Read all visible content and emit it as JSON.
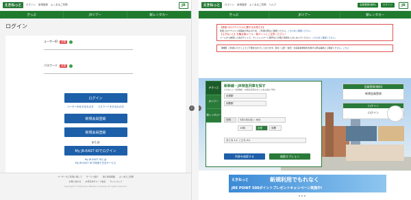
{
  "left": {
    "header": {
      "logo": "えきねっと",
      "links": [
        "ログイン",
        "新規登録",
        "よくあるご質問"
      ],
      "jr_mark": "JR"
    },
    "nav": [
      "きっぷ",
      "JRツアー",
      "駅レンタカー"
    ],
    "title": "ログイン",
    "fields": [
      {
        "label": "ユーザーID",
        "required": "必須"
      },
      {
        "label": "パスワード",
        "required": "必須"
      }
    ],
    "login_button": "ログイン",
    "links_row": [
      "ユーザーIDをお忘れの方",
      "パスワードをお忘れの方"
    ],
    "register_button_1": "新規会員登録",
    "register_button_2": "新規会員登録",
    "or_text": "または",
    "jre_button": "My JR-EAST IDでログイン",
    "small_links": [
      "My JR-EAST IDとは",
      "My JR-EAST IDで利用できるサービス"
    ],
    "footer_links": [
      "ユーザーのご利用に関して",
      "サービス紹介",
      "個人情報保護",
      "よくあるご質問"
    ],
    "footer_links2": [
      "お問い合わせ",
      "JR東日本グループ会社",
      "サイトマップ"
    ],
    "copyright": "Copyright © East Japan Railway Company All rights reserved."
  },
  "right": {
    "header": {
      "logo": "えきねっと",
      "links": [
        "ログイン",
        "新規登録",
        "よくあるご質問",
        "ヘルプ"
      ],
      "menu_buttons": [
        "会員登録(無料)",
        "ログイン"
      ],
      "jr_mark": "JR"
    },
    "nav": [
      "きっぷ",
      "JRツアー",
      "駅レンタカー"
    ],
    "notice1": {
      "title": "【新型コロナウイルスに関するお知らせ】",
      "line1": "新型コロナウイルス感染拡大防止のため、ご利用の際はご確認ください。",
      "link1": "こちらをご確認ください。",
      "line2": "【えきねっと】を騙る偽メール・偽サイトにご注意ください！",
      "line3": "メールから誘導した先のサイトで、クレジットカード番号などの個人情報を入力しないでください。",
      "link2": "こちらをご確認ください。"
    },
    "notice2": {
      "text": "【重要】ご利用いただく上でご不便をおかけしております。東北・山形・秋田・北海道新幹線を利用する際は事前にご確認ください。",
      "link": "こちら"
    },
    "booking": {
      "title": "新幹線・JR特急列車を探す",
      "sub": "えきねっとで新幹線・JR特急列車のきっぷをお得に予約",
      "tabs": [
        "JRきっぷ",
        "JRツアー",
        "駅レンタカー"
      ],
      "from": "出発駅",
      "to": "到着駅",
      "date_label": "日時",
      "date": "3月14日(月)・木日",
      "time": "10時",
      "time_opts": [
        "出発",
        "到着"
      ],
      "people": "おとな 1人 こども 0人",
      "search_button": "列車を検索する",
      "other_button": "検索オプション"
    },
    "side": [
      {
        "head": "会員登録(無料)",
        "body": "新規会員登録"
      },
      {
        "head": "ログイン",
        "body": "ログイン"
      }
    ],
    "banner": {
      "brand": "えきねっと",
      "title": "新規利用でもれなく",
      "sub": "JRE POINT 500ポイントプレゼントキャンペーン実施中!"
    },
    "colors": {
      "green": "#2a7a3a",
      "blue": "#1d5fa8",
      "red": "#e05050"
    }
  }
}
